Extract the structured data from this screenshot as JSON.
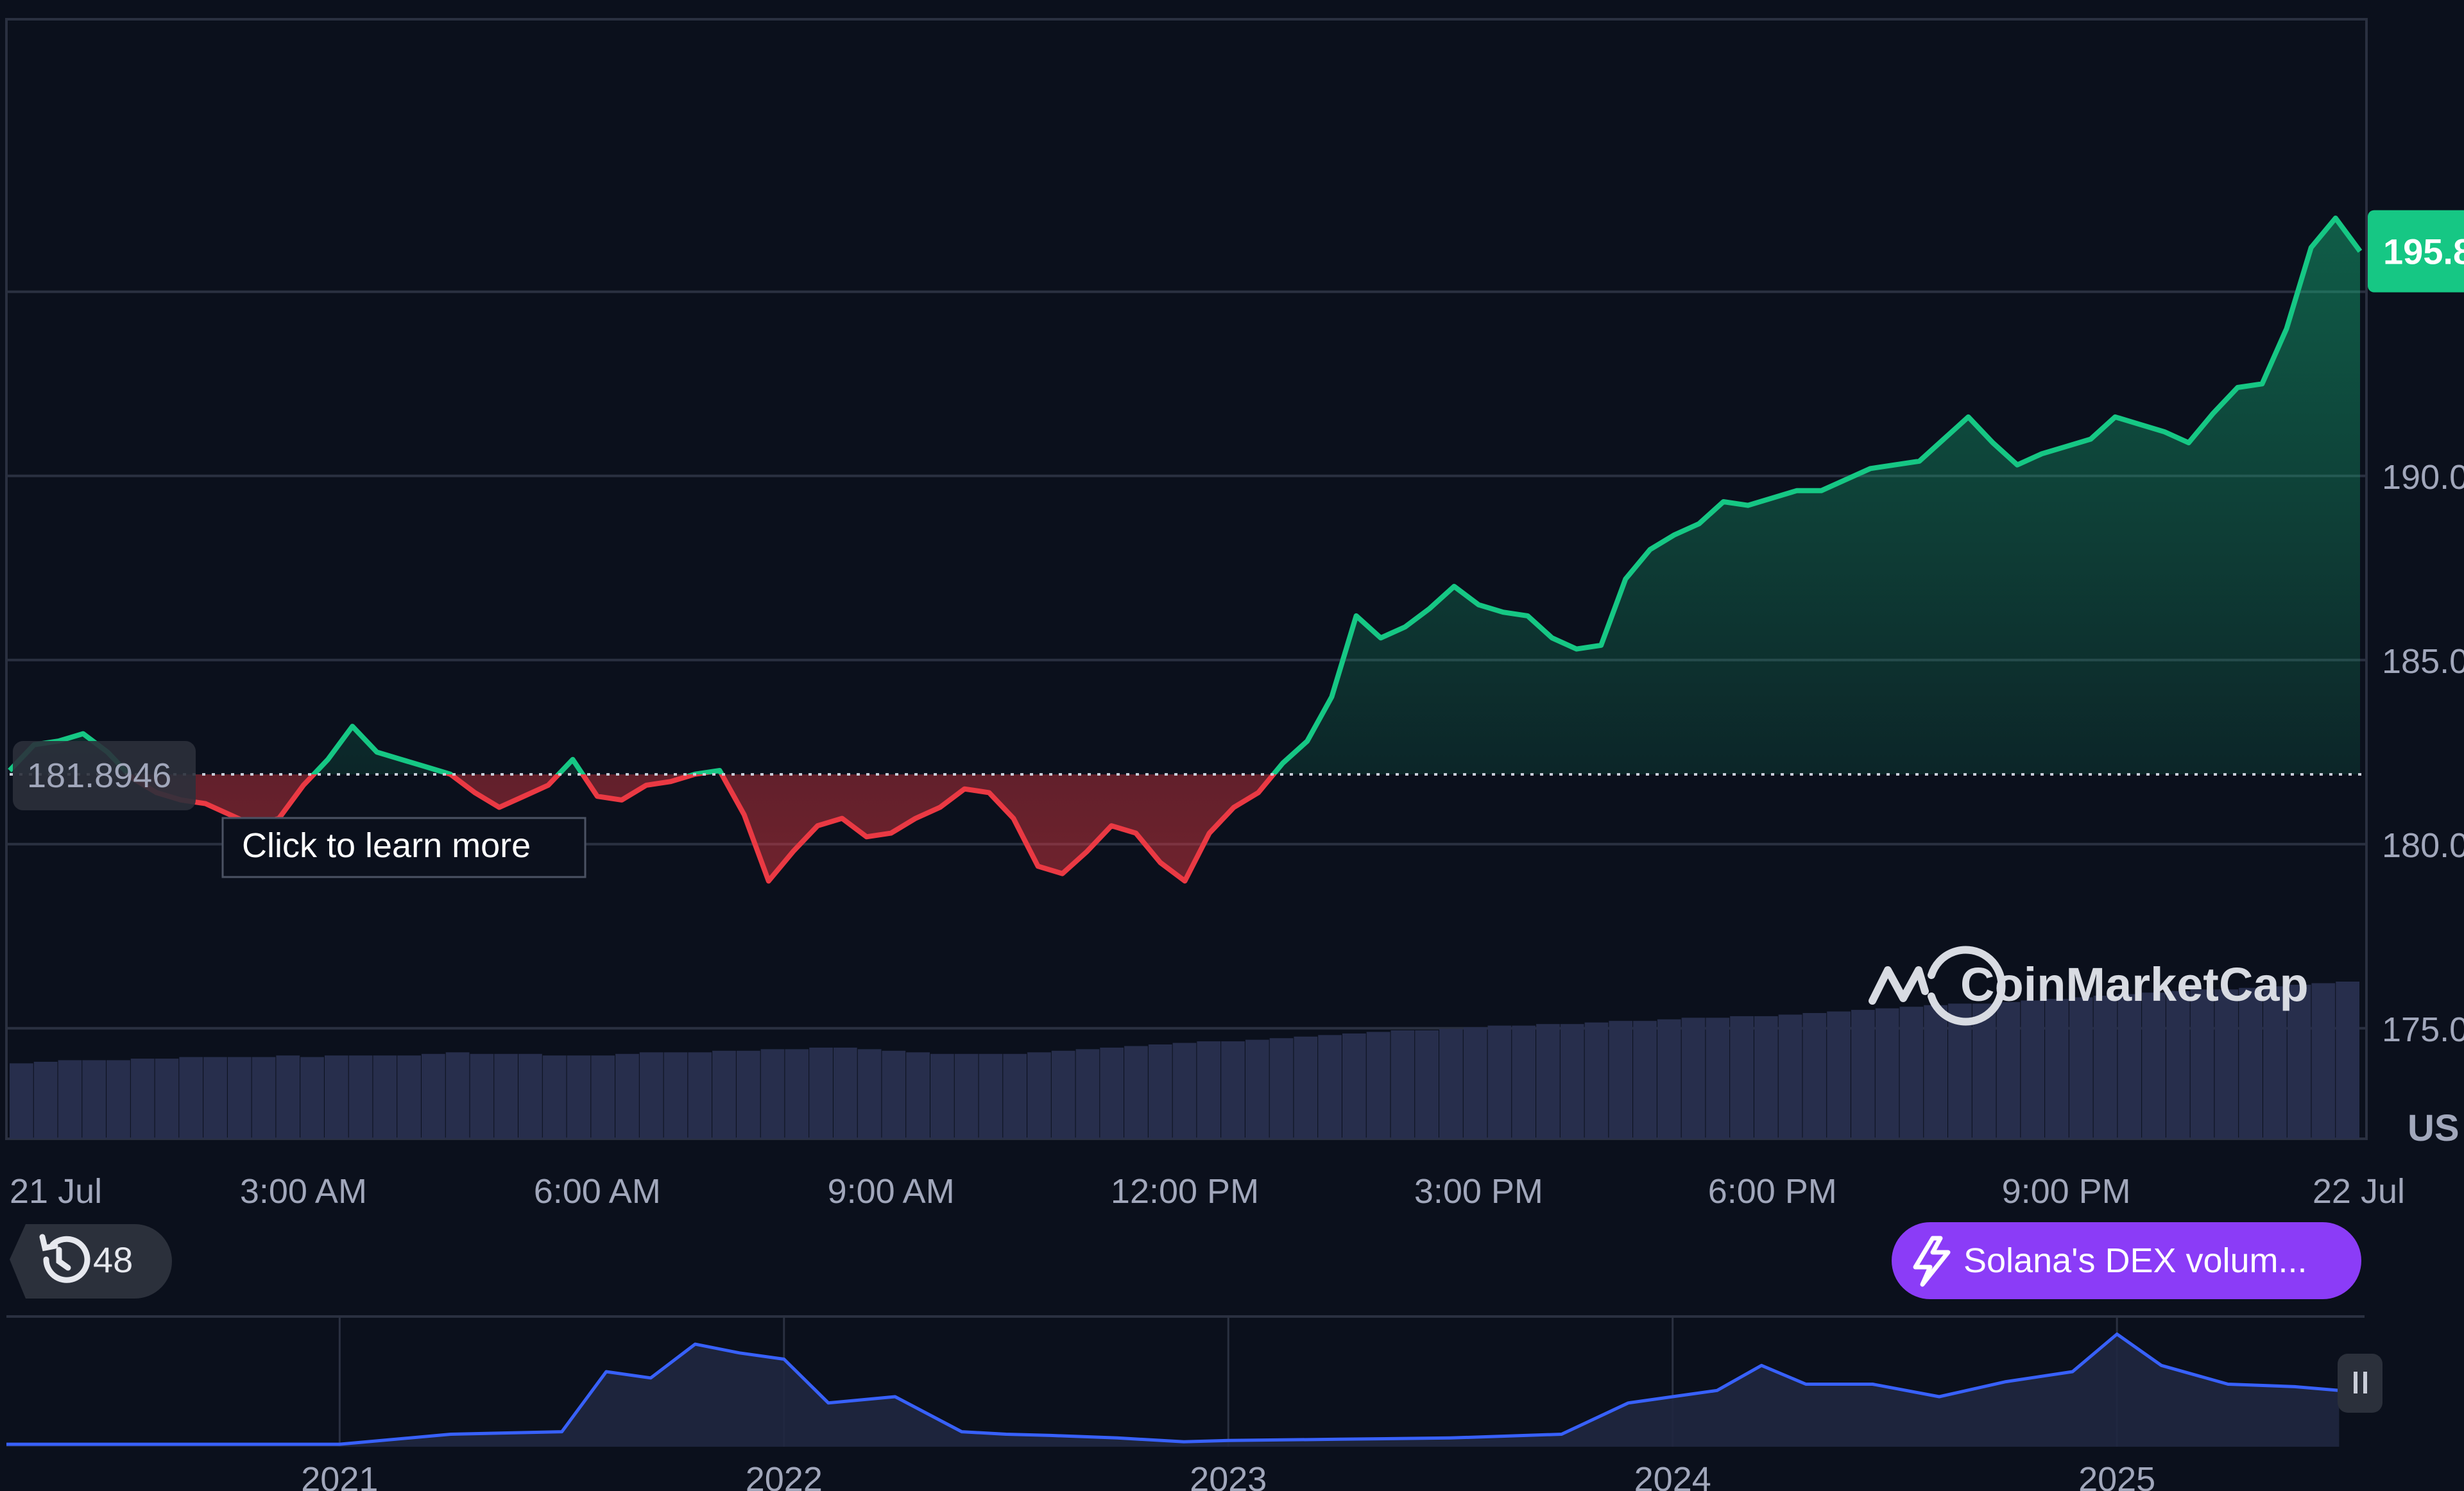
{
  "colors": {
    "background": "#0b101c",
    "up": "#16c784",
    "down": "#ea3943",
    "grid": "#2a3040",
    "text": "#a1a7bb",
    "volume": "#2a3150",
    "overview_line": "#3861fb",
    "news_pill": "#8b3cf7"
  },
  "price_label": "195.8",
  "reference_label": "181.8946",
  "tooltip": "Click to learn more",
  "watermark": "CoinMarketCap",
  "currency_label": "US",
  "history_count": "48",
  "news_pill": "Solana's DEX volum...",
  "chart_data": [
    {
      "type": "line",
      "x_ticks": [
        "21 Jul",
        "3:00 AM",
        "6:00 AM",
        "9:00 AM",
        "12:00 PM",
        "3:00 PM",
        "6:00 PM",
        "9:00 PM",
        "22 Jul"
      ],
      "y_ticks": [
        "175.0",
        "180.0",
        "185.0",
        "190.0"
      ],
      "ylim": [
        172,
        202.4
      ],
      "baseline": 181.8946,
      "grid": "horizontal",
      "x_hours": [
        0,
        0.25,
        0.5,
        0.75,
        1,
        1.25,
        1.5,
        1.75,
        2,
        2.25,
        2.5,
        2.75,
        3,
        3.25,
        3.5,
        3.75,
        4,
        4.25,
        4.5,
        4.75,
        5,
        5.25,
        5.5,
        5.75,
        6,
        6.25,
        6.5,
        6.75,
        7,
        7.25,
        7.5,
        7.75,
        8,
        8.25,
        8.5,
        8.75,
        9,
        9.25,
        9.5,
        9.75,
        10,
        10.25,
        10.5,
        10.75,
        11,
        11.25,
        11.5,
        11.75,
        12,
        12.25,
        12.5,
        12.75,
        13,
        13.25,
        13.5,
        13.75,
        14,
        14.25,
        14.5,
        14.75,
        15,
        15.25,
        15.5,
        15.75,
        16,
        16.25,
        16.5,
        16.75,
        17,
        17.25,
        17.5,
        17.75,
        18,
        18.25,
        18.5,
        18.75,
        19,
        19.25,
        19.5,
        19.75,
        20,
        20.25,
        20.5,
        20.75,
        21,
        21.25,
        21.5,
        21.75,
        22,
        22.25,
        22.5,
        22.75,
        23,
        23.25,
        23.5,
        23.75,
        24
      ],
      "prices": [
        182.0,
        182.7,
        182.8,
        183.0,
        182.5,
        181.8,
        181.4,
        181.2,
        181.1,
        180.8,
        180.5,
        180.7,
        181.6,
        182.3,
        183.2,
        182.5,
        182.3,
        182.1,
        181.9,
        181.4,
        181.0,
        181.3,
        181.6,
        182.3,
        181.3,
        181.2,
        181.6,
        181.7,
        181.9,
        182.0,
        180.8,
        179.0,
        179.8,
        180.5,
        180.7,
        180.2,
        180.3,
        180.7,
        181.0,
        181.5,
        181.4,
        180.7,
        179.4,
        179.2,
        179.8,
        180.5,
        180.3,
        179.5,
        179.0,
        180.3,
        181.0,
        181.4,
        182.2,
        182.8,
        184.0,
        186.2,
        185.6,
        185.9,
        186.4,
        187.0,
        186.5,
        186.3,
        186.2,
        185.6,
        185.3,
        185.4,
        187.2,
        188.0,
        188.4,
        188.7,
        189.3,
        189.2,
        189.4,
        189.6,
        189.6,
        189.9,
        190.2,
        190.3,
        190.4,
        191.0,
        191.6,
        190.9,
        190.3,
        190.6,
        190.8,
        191.0,
        191.6,
        191.4,
        191.2,
        190.9,
        191.7,
        192.4,
        192.5,
        194.0,
        196.2,
        197.0,
        196.1,
        195.6
      ],
      "volume_fraction": [
        0.48,
        0.49,
        0.5,
        0.5,
        0.5,
        0.51,
        0.51,
        0.52,
        0.52,
        0.52,
        0.52,
        0.53,
        0.52,
        0.53,
        0.53,
        0.53,
        0.53,
        0.54,
        0.55,
        0.54,
        0.54,
        0.54,
        0.53,
        0.53,
        0.53,
        0.54,
        0.55,
        0.55,
        0.55,
        0.56,
        0.56,
        0.57,
        0.57,
        0.58,
        0.58,
        0.57,
        0.56,
        0.55,
        0.54,
        0.54,
        0.54,
        0.54,
        0.55,
        0.56,
        0.57,
        0.58,
        0.59,
        0.6,
        0.61,
        0.62,
        0.62,
        0.63,
        0.64,
        0.65,
        0.66,
        0.67,
        0.68,
        0.69,
        0.69,
        0.7,
        0.71,
        0.72,
        0.72,
        0.73,
        0.73,
        0.74,
        0.75,
        0.75,
        0.76,
        0.77,
        0.77,
        0.78,
        0.78,
        0.79,
        0.8,
        0.81,
        0.82,
        0.83,
        0.84,
        0.85,
        0.86,
        0.86,
        0.87,
        0.88,
        0.89,
        0.9,
        0.91,
        0.92,
        0.93,
        0.94,
        0.95,
        0.95,
        0.96,
        0.97,
        0.98,
        0.99,
        1.0
      ]
    },
    {
      "type": "line",
      "x_ticks": [
        "2021",
        "2022",
        "2023",
        "2024",
        "2025"
      ],
      "x_years": [
        2020.25,
        2020.5,
        2020.75,
        2021.0,
        2021.25,
        2021.5,
        2021.6,
        2021.7,
        2021.8,
        2021.9,
        2022.0,
        2022.1,
        2022.25,
        2022.4,
        2022.5,
        2022.6,
        2022.75,
        2022.9,
        2023.0,
        2023.25,
        2023.5,
        2023.75,
        2023.9,
        2024.0,
        2024.1,
        2024.2,
        2024.3,
        2024.45,
        2024.6,
        2024.75,
        2024.9,
        2025.0,
        2025.1,
        2025.25,
        2025.4,
        2025.5
      ],
      "values": [
        0.02,
        0.02,
        0.02,
        0.02,
        0.1,
        0.12,
        0.6,
        0.55,
        0.82,
        0.75,
        0.7,
        0.35,
        0.4,
        0.12,
        0.1,
        0.09,
        0.07,
        0.04,
        0.05,
        0.06,
        0.07,
        0.1,
        0.35,
        0.4,
        0.45,
        0.65,
        0.5,
        0.5,
        0.4,
        0.52,
        0.6,
        0.9,
        0.65,
        0.5,
        0.48,
        0.45
      ]
    }
  ]
}
